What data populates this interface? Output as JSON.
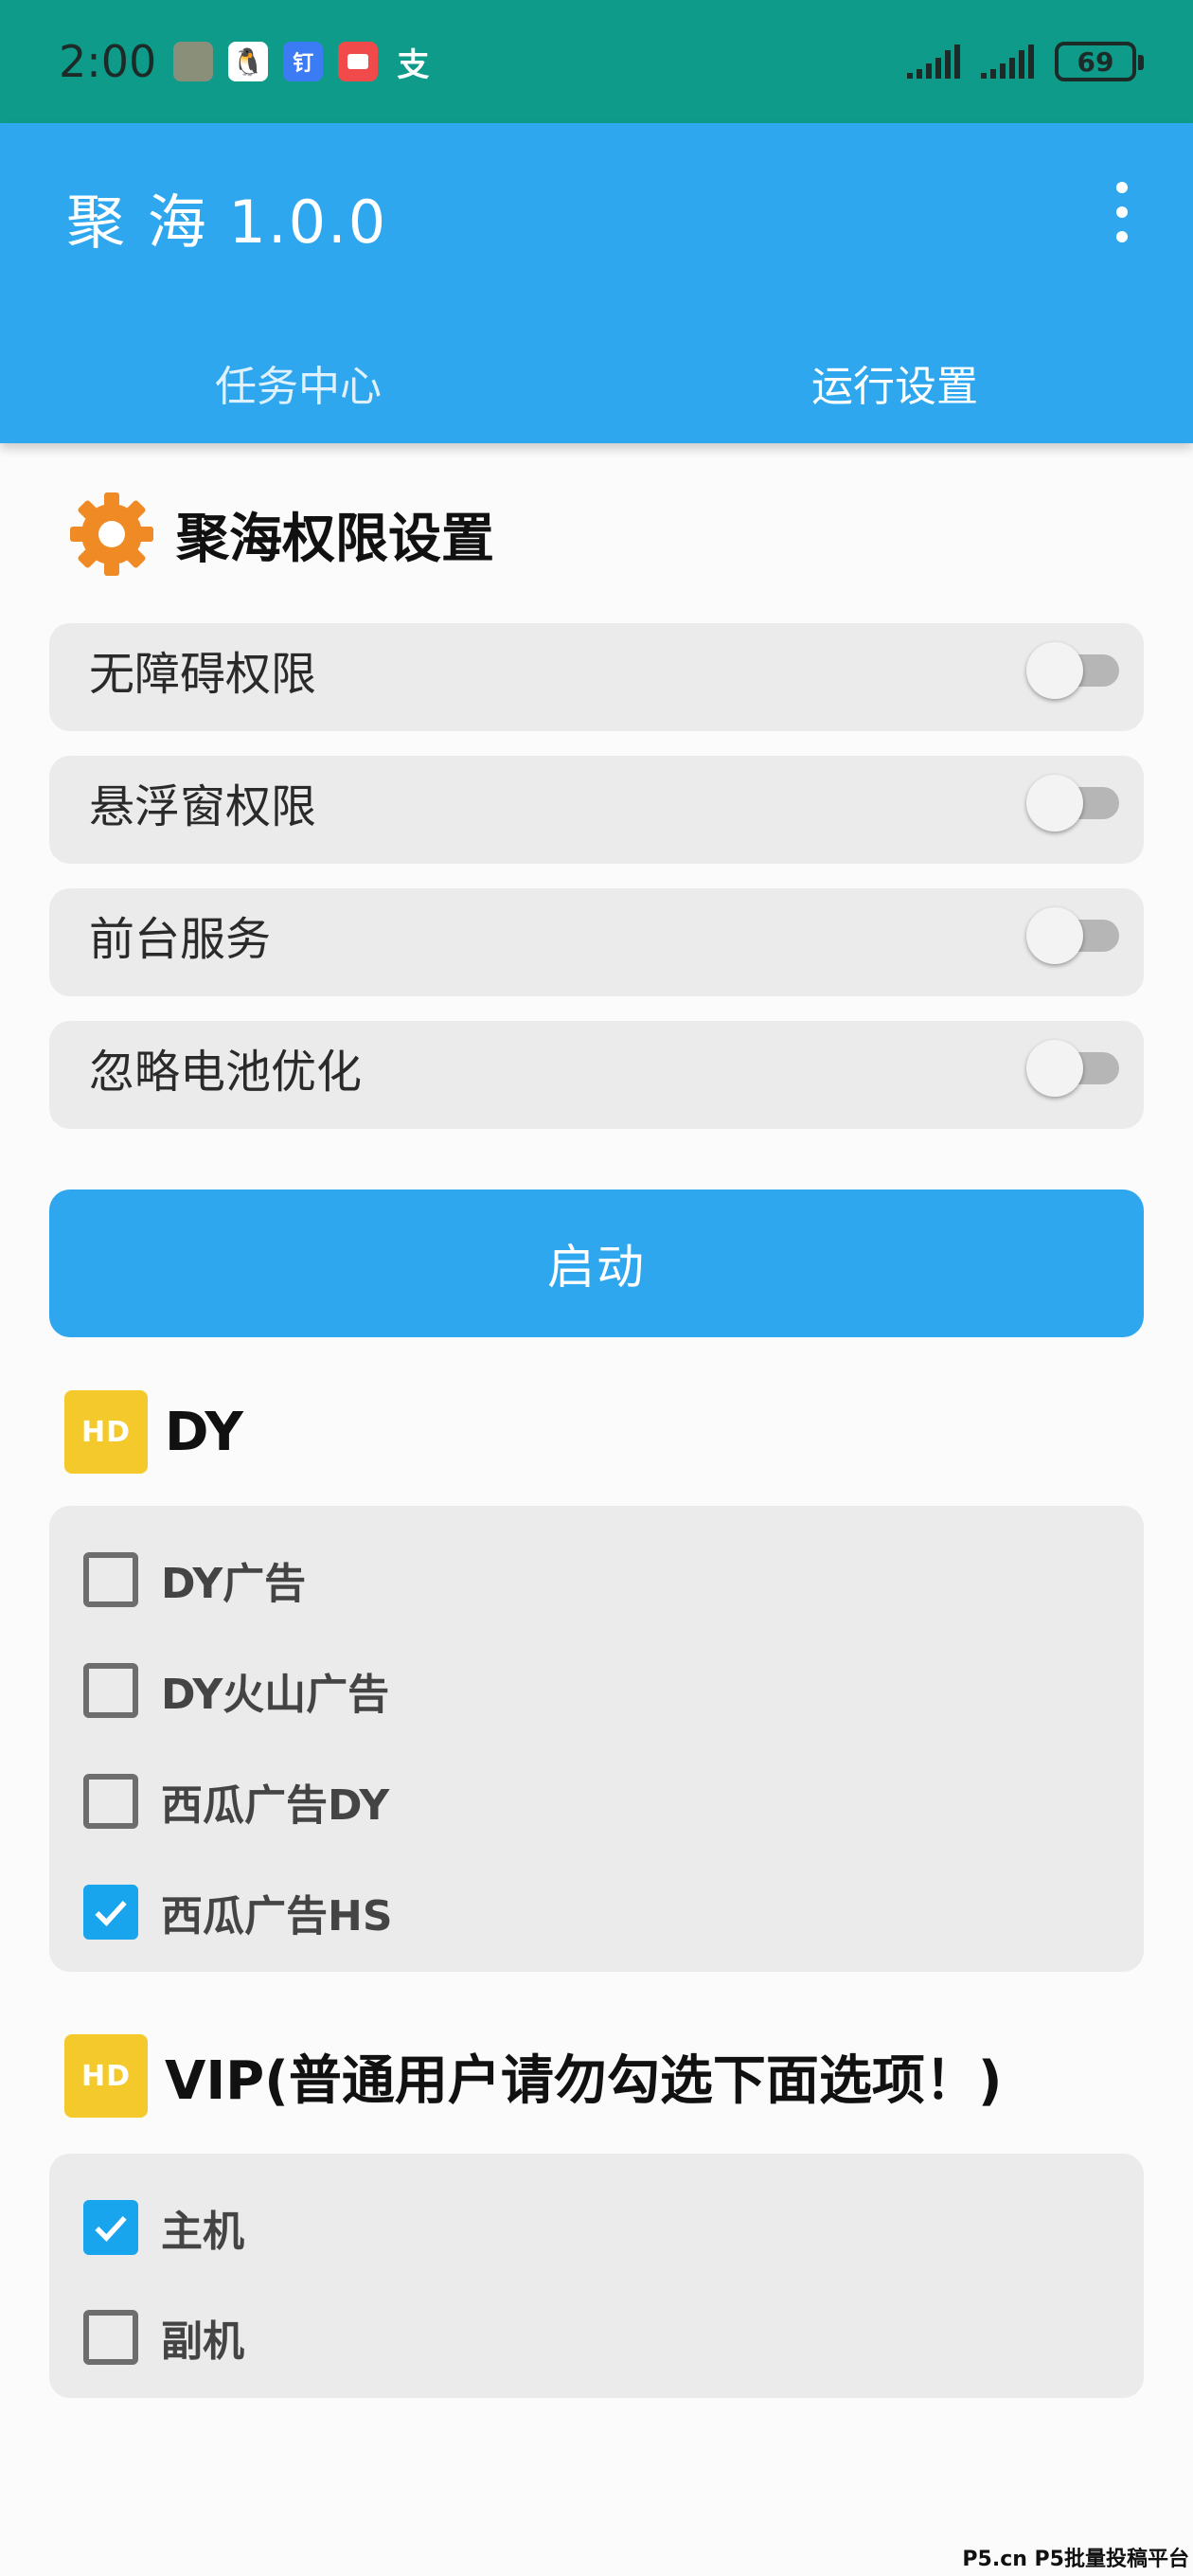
{
  "status_bar": {
    "time": "2:00",
    "app_icons": [
      {
        "name": "photo-thumbnail-icon",
        "color": "#8a8f7a",
        "glyph": ""
      },
      {
        "name": "qq-icon",
        "color": "#ffffff",
        "glyph": "🐧"
      },
      {
        "name": "dingtalk-icon",
        "color": "#3b7cf4",
        "glyph": "钉"
      },
      {
        "name": "message-icon",
        "color": "#f04a4a",
        "glyph": ""
      },
      {
        "name": "alipay-icon",
        "color": "transparent",
        "glyph": "支"
      }
    ],
    "battery": "69"
  },
  "app_bar": {
    "title": "聚 海 1.0.0",
    "tabs": [
      {
        "label": "任务中心"
      },
      {
        "label": "运行设置"
      }
    ]
  },
  "permissions": {
    "title": "聚海权限设置",
    "items": [
      {
        "label": "无障碍权限",
        "enabled": false
      },
      {
        "label": "悬浮窗权限",
        "enabled": false
      },
      {
        "label": "前台服务",
        "enabled": false
      },
      {
        "label": "忽略电池优化",
        "enabled": false
      }
    ]
  },
  "start_button": {
    "label": "启动"
  },
  "dy_section": {
    "icon_text": "HD",
    "title": "DY",
    "options": [
      {
        "label": "DY广告",
        "checked": false
      },
      {
        "label": "DY火山广告",
        "checked": false
      },
      {
        "label": "西瓜广告DY",
        "checked": false
      },
      {
        "label": "西瓜广告HS",
        "checked": true
      }
    ]
  },
  "vip_section": {
    "icon_text": "HD",
    "title": "VIP(普通用户请勿勾选下面选项！)",
    "options": [
      {
        "label": "主机",
        "checked": true
      },
      {
        "label": "副机",
        "checked": false
      }
    ]
  },
  "watermark": "P5.cn P5批量投稿平台",
  "colors": {
    "status_bar": "#0f9b8a",
    "accent": "#2fa7ef",
    "checkbox_checked": "#19a5ee",
    "hd_icon": "#f4c92b",
    "gear_icon": "#f08a24"
  }
}
